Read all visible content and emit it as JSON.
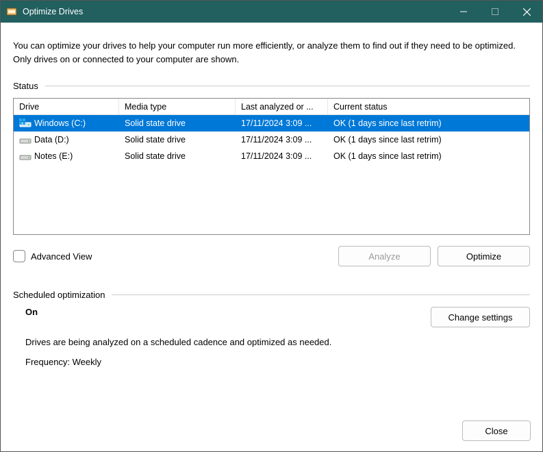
{
  "window": {
    "title": "Optimize Drives"
  },
  "description": "You can optimize your drives to help your computer run more efficiently, or analyze them to find out if they need to be optimized. Only drives on or connected to your computer are shown.",
  "status_label": "Status",
  "columns": {
    "drive": "Drive",
    "media": "Media type",
    "last": "Last analyzed or ...",
    "status": "Current status"
  },
  "drives": [
    {
      "name": "Windows (C:)",
      "media": "Solid state drive",
      "last": "17/11/2024 3:09 ...",
      "status": "OK (1 days since last retrim)",
      "selected": true,
      "win": true
    },
    {
      "name": "Data (D:)",
      "media": "Solid state drive",
      "last": "17/11/2024 3:09 ...",
      "status": "OK (1 days since last retrim)",
      "selected": false,
      "win": false
    },
    {
      "name": "Notes (E:)",
      "media": "Solid state drive",
      "last": "17/11/2024 3:09 ...",
      "status": "OK (1 days since last retrim)",
      "selected": false,
      "win": false
    }
  ],
  "advanced_view_label": "Advanced View",
  "buttons": {
    "analyze": "Analyze",
    "optimize": "Optimize",
    "change_settings": "Change settings",
    "close": "Close"
  },
  "scheduled": {
    "header": "Scheduled optimization",
    "state": "On",
    "line1": "Drives are being analyzed on a scheduled cadence and optimized as needed.",
    "line2": "Frequency: Weekly"
  }
}
